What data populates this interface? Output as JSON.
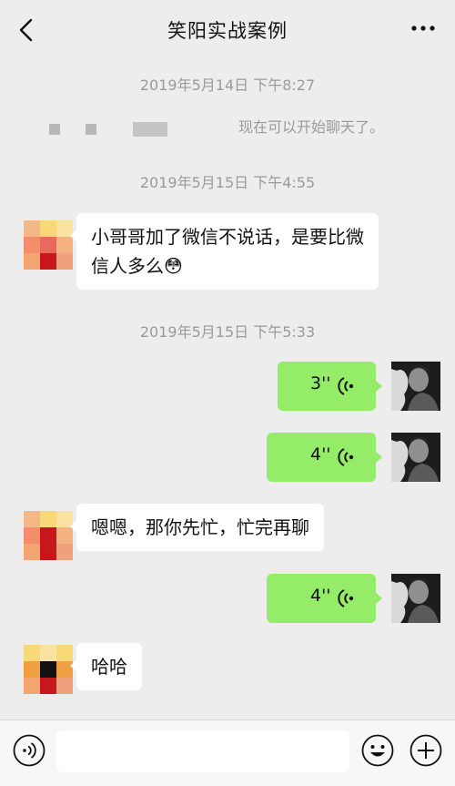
{
  "header": {
    "title": "笑阳实战案例"
  },
  "messages": {
    "ts1": "2019年5月14日 下午8:27",
    "system_text": "现在可以开始聊天了。",
    "ts2": "2019年5月15日 下午4:55",
    "msg1": "小哥哥加了微信不说话，是要比微信人多么",
    "msg1_emoji": "😳",
    "ts3": "2019年5月15日 下午5:33",
    "voice1": "3''",
    "voice2": "4''",
    "msg2": "嗯嗯，那你先忙，忙完再聊",
    "voice3": "4''",
    "msg3": "哈哈"
  },
  "input": {
    "placeholder": ""
  },
  "colors": {
    "background": "#ededed",
    "sent_bubble": "#95ec69",
    "received_bubble": "#ffffff",
    "timestamp": "#9a9a9a"
  },
  "icons": {
    "back": "chevron-left-icon",
    "more": "more-dots-icon",
    "voice": "voice-wave-icon",
    "mic": "voice-input-icon",
    "emoji": "emoji-icon",
    "plus": "plus-icon"
  }
}
